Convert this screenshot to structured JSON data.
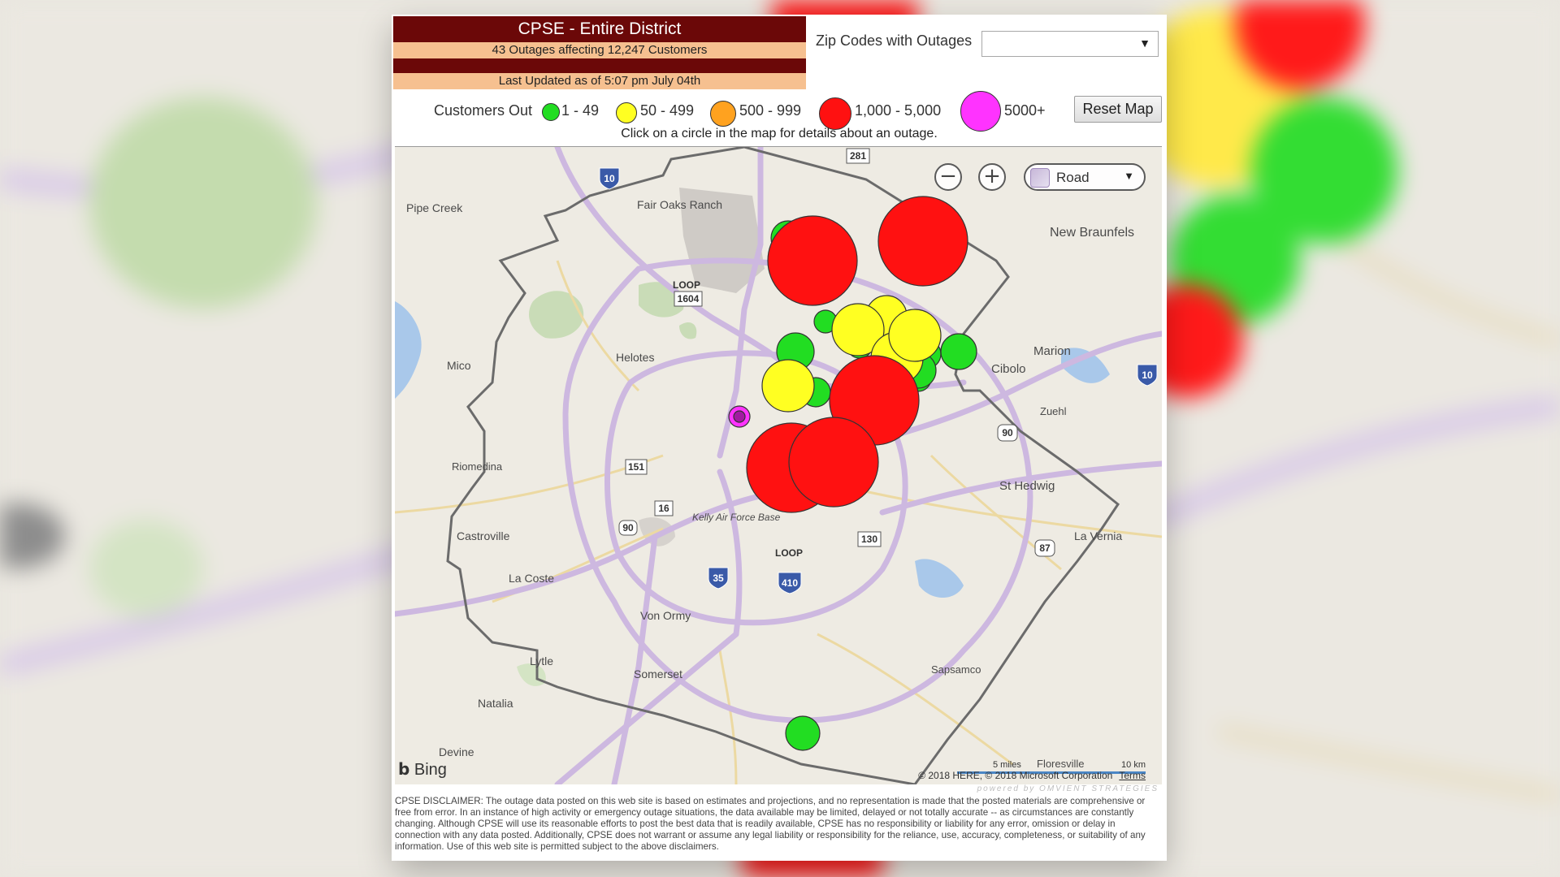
{
  "header": {
    "title": "CPSE - Entire District",
    "summary": "43 Outages affecting 12,247 Customers",
    "last_updated": "Last Updated as of 5:07 pm July 04th"
  },
  "zip_filter": {
    "label": "Zip Codes with Outages",
    "value": ""
  },
  "legend": {
    "title": "Customers Out",
    "items": [
      {
        "label": "1 - 49",
        "color": "#22dd22"
      },
      {
        "label": "50 - 499",
        "color": "#ffff22"
      },
      {
        "label": "500 - 999",
        "color": "#ffa21f"
      },
      {
        "label": "1,000 - 5,000",
        "color": "#ff1111"
      },
      {
        "label": "5000+",
        "color": "#ff33ff"
      }
    ]
  },
  "reset_button": "Reset Map",
  "hint": "Click on a circle in the map for details about an outage.",
  "map": {
    "zoom_out_icon": "minus-icon",
    "zoom_in_icon": "plus-icon",
    "style_selector": "Road",
    "places": [
      "Pipe Creek",
      "Fair Oaks Ranch",
      "New Braunfels",
      "Helotes",
      "Mico",
      "Marion",
      "Cibolo",
      "Zuehl",
      "Riomedina",
      "St Hedwig",
      "Castroville",
      "La Vernia",
      "La Coste",
      "Kelly Air Force Base",
      "Von Ormy",
      "Lytle",
      "Somerset",
      "Sapsamco",
      "Natalia",
      "Floresville",
      "Devine"
    ],
    "loop_labels": [
      "LOOP",
      "LOOP"
    ],
    "highway_shields": [
      "10",
      "281",
      "1604",
      "151",
      "16",
      "90",
      "35",
      "410",
      "130",
      "87",
      "90",
      "10"
    ],
    "scale_miles": "5 miles",
    "scale_km": "10 km",
    "attribution": "© 2018 HERE, © 2018 Microsoft Corporation",
    "terms": "Terms",
    "bing": "Bing",
    "powered_by": "powered by OMVIENT STRATEGIES"
  },
  "disclaimer": "CPSE DISCLAIMER:  The outage data posted on this web site is based on estimates and projections, and no representation is made that the posted materials are comprehensive or free from error.  In an instance of high activity or emergency outage situations, the data available may be limited, delayed or not totally accurate -- as circumstances are constantly changing.  Although CPSE will use its reasonable efforts to post the best data that is readily available, CPSE has no responsibility or liability for any error, omission or delay in connection with any data posted.  Additionally, CPSE does not warrant or assume any legal liability or responsibility for the reliance, use, accuracy, completeness, or suitability of any information.  Use of this web site is permitted subject to the above disclaimers."
}
